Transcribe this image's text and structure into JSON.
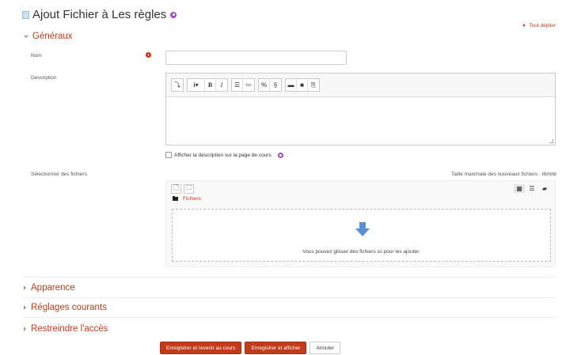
{
  "page": {
    "title": "Ajout Fichier à Les règles",
    "expand_all": "Tout déplier"
  },
  "sections": {
    "general": "Généraux",
    "appearance": "Apparence",
    "common": "Réglages courants",
    "restrict": "Restreindre l'accès"
  },
  "form": {
    "name_label": "Nom",
    "name_value": "",
    "description_label": "Description",
    "show_description": "Afficher la description sur la page de cours",
    "files_label": "Sélectionner des fichiers",
    "max_size": "Taille maximale des nouveaux fichiers : Illimité"
  },
  "editor": {
    "toolbar": [
      [
        "collapse-icon"
      ],
      [
        "info-icon",
        "bold-icon",
        "italic-icon"
      ],
      [
        "bullet-list-icon",
        "numbered-list-icon"
      ],
      [
        "link-icon",
        "unlink-icon"
      ],
      [
        "image-icon",
        "video-icon",
        "manage-files-icon"
      ]
    ]
  },
  "filepicker": {
    "path_label": "Fichiers",
    "drop_text": "Vous pouvez glisser des fichiers ici pour les ajouter.",
    "colors": {
      "arrow": "#5a8fd4"
    }
  },
  "buttons": {
    "save_return": "Enregistrer et revenir au cours",
    "save_display": "Enregistrer et afficher",
    "cancel": "Annuler"
  },
  "colors": {
    "accent": "#c23c1c",
    "help": "#a64cc7"
  }
}
